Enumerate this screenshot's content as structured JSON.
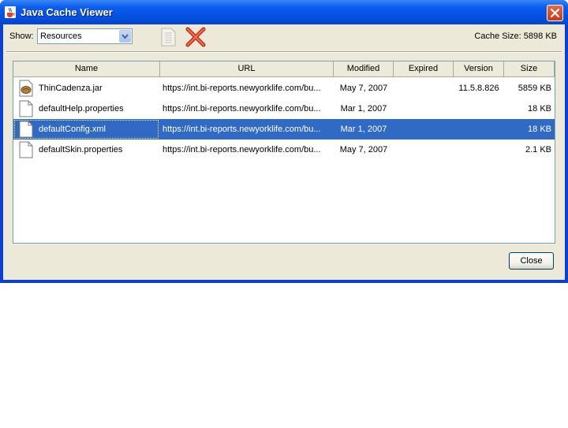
{
  "window": {
    "title": "Java Cache Viewer"
  },
  "toolbar": {
    "show_label": "Show:",
    "show_value": "Resources",
    "cache_size_label": "Cache Size:",
    "cache_size_value": "5898 KB"
  },
  "table": {
    "columns": [
      "Name",
      "URL",
      "Modified",
      "Expired",
      "Version",
      "Size"
    ],
    "rows": [
      {
        "icon": "jar-file-icon",
        "name": "ThinCadenza.jar",
        "url": "https://int.bi-reports.newyorklife.com/bu...",
        "modified": "May 7, 2007",
        "expired": "",
        "version": "11.5.8.826",
        "size": "5859 KB",
        "selected": false
      },
      {
        "icon": "document-icon",
        "name": "defaultHelp.properties",
        "url": "https://int.bi-reports.newyorklife.com/bu...",
        "modified": "Mar 1, 2007",
        "expired": "",
        "version": "",
        "size": "18 KB",
        "selected": false
      },
      {
        "icon": "document-icon",
        "name": "defaultConfig.xml",
        "url": "https://int.bi-reports.newyorklife.com/bu...",
        "modified": "Mar 1, 2007",
        "expired": "",
        "version": "",
        "size": "18 KB",
        "selected": true
      },
      {
        "icon": "document-icon",
        "name": "defaultSkin.properties",
        "url": "https://int.bi-reports.newyorklife.com/bu...",
        "modified": "May 7, 2007",
        "expired": "",
        "version": "",
        "size": "2.1 KB",
        "selected": false
      }
    ]
  },
  "footer": {
    "close_label": "Close"
  },
  "colors": {
    "titlebar": "#0550e0",
    "selection": "#316ac5",
    "dialog_bg": "#ece9d8"
  }
}
